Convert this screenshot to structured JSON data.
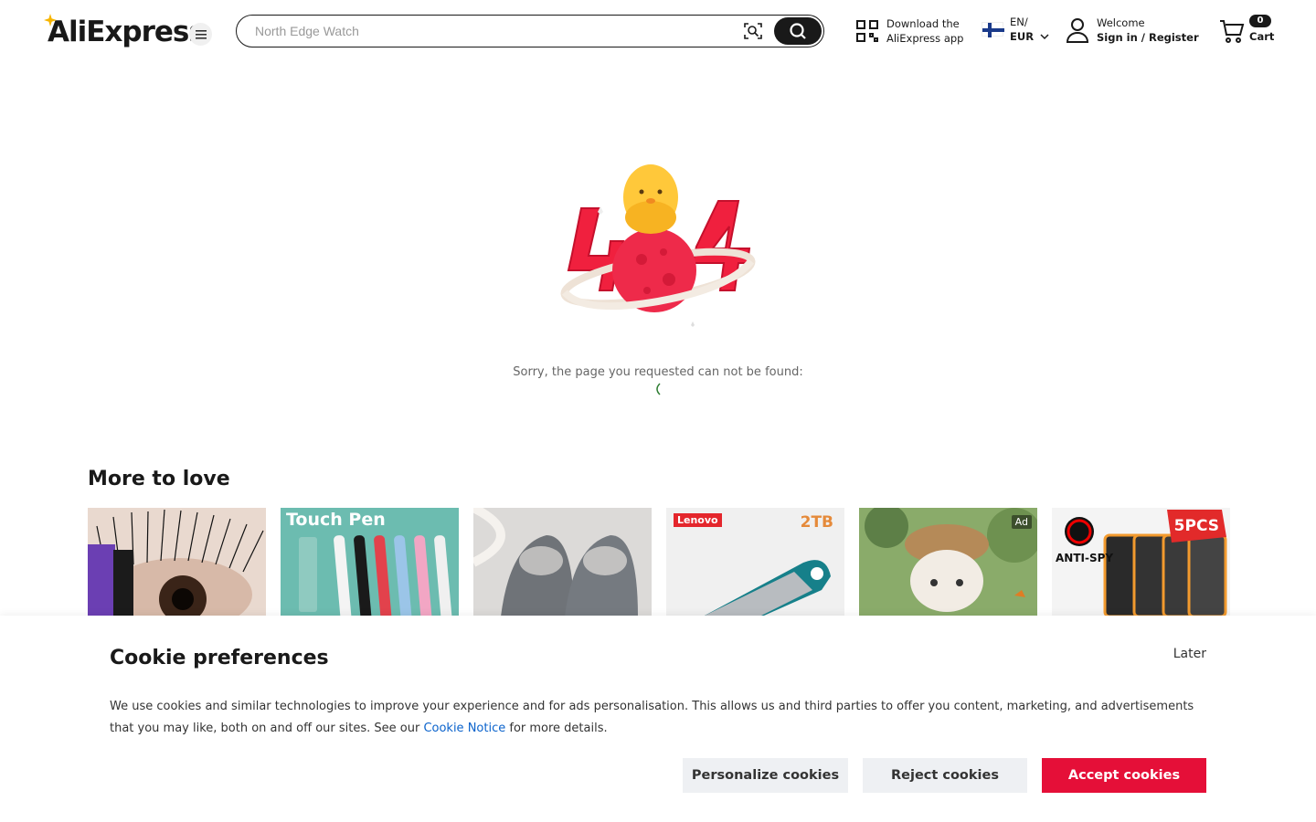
{
  "header": {
    "logo": "AliExpress",
    "search_placeholder": "North Edge Watch",
    "download_line1": "Download the",
    "download_line2": "AliExpress app",
    "language": "EN/",
    "currency": "EUR",
    "welcome": "Welcome",
    "signin": "Sign in / Register",
    "cart_count": "0",
    "cart_label": "Cart"
  },
  "error": {
    "message": "Sorry, the page you requested can not be found:",
    "illustration_number": "404"
  },
  "more_to_love": {
    "title": "More to love",
    "products": [
      {
        "name": "eyelash-product",
        "text": ""
      },
      {
        "name": "touch-pen-product",
        "text": "Touch Pen"
      },
      {
        "name": "slippers-product",
        "text": ""
      },
      {
        "name": "usb-drive-product",
        "brand": "Lenovo",
        "capacity": "2TB"
      },
      {
        "name": "plush-toy-product",
        "ad": "Ad"
      },
      {
        "name": "screen-protector-product",
        "text": "ANTI-SPY",
        "badge": "5PCS"
      }
    ]
  },
  "cookie": {
    "title": "Cookie preferences",
    "later": "Later",
    "text_before_link": "We use cookies and similar technologies to improve your experience and for ads personalisation. This allows us and third parties to offer you content, marketing, and advertisements that you may like, both on and off our sites. See our ",
    "link": "Cookie Notice",
    "text_after_link": " for more details.",
    "personalize": "Personalize cookies",
    "reject": "Reject cookies",
    "accept": "Accept cookies"
  },
  "colors": {
    "accent": "#e50f38",
    "link": "#0b63cc",
    "text": "#191919"
  }
}
